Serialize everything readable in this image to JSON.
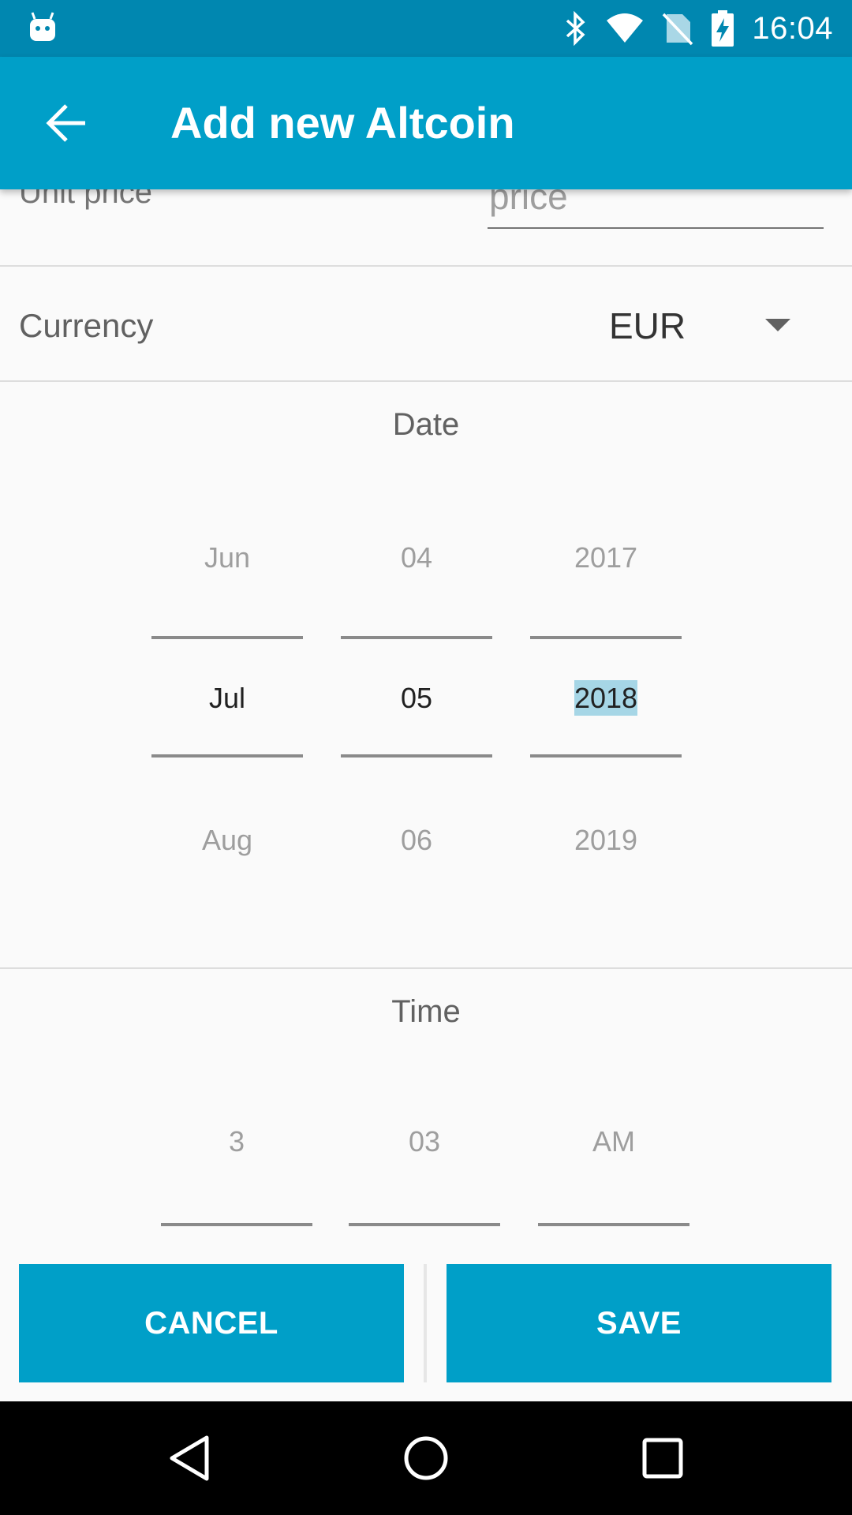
{
  "status_bar": {
    "time": "16:04",
    "icons": [
      "android-debug-icon",
      "bluetooth-icon",
      "wifi-icon",
      "no-sim-icon",
      "battery-charging-icon"
    ]
  },
  "app_bar": {
    "title": "Add new Altcoin",
    "back_icon": "arrow-back-icon"
  },
  "unit_price": {
    "label": "Unit price",
    "placeholder": "price",
    "value": ""
  },
  "currency": {
    "label": "Currency",
    "selected": "EUR"
  },
  "date": {
    "title": "Date",
    "month": {
      "prev": "Jun",
      "current": "Jul",
      "next": "Aug"
    },
    "day": {
      "prev": "04",
      "current": "05",
      "next": "06"
    },
    "year": {
      "prev": "2017",
      "current": "2018",
      "next": "2019"
    }
  },
  "time": {
    "title": "Time",
    "hour": {
      "prev": "3"
    },
    "minute": {
      "prev": "03"
    },
    "ampm": {
      "prev": "AM"
    }
  },
  "actions": {
    "cancel_label": "CANCEL",
    "save_label": "SAVE"
  },
  "nav_bar": {
    "icons": [
      "nav-back-icon",
      "nav-home-icon",
      "nav-recents-icon"
    ]
  },
  "colors": {
    "primary": "#009fc8",
    "primary_dark": "#0087b0",
    "highlight": "#a6d6e6"
  }
}
